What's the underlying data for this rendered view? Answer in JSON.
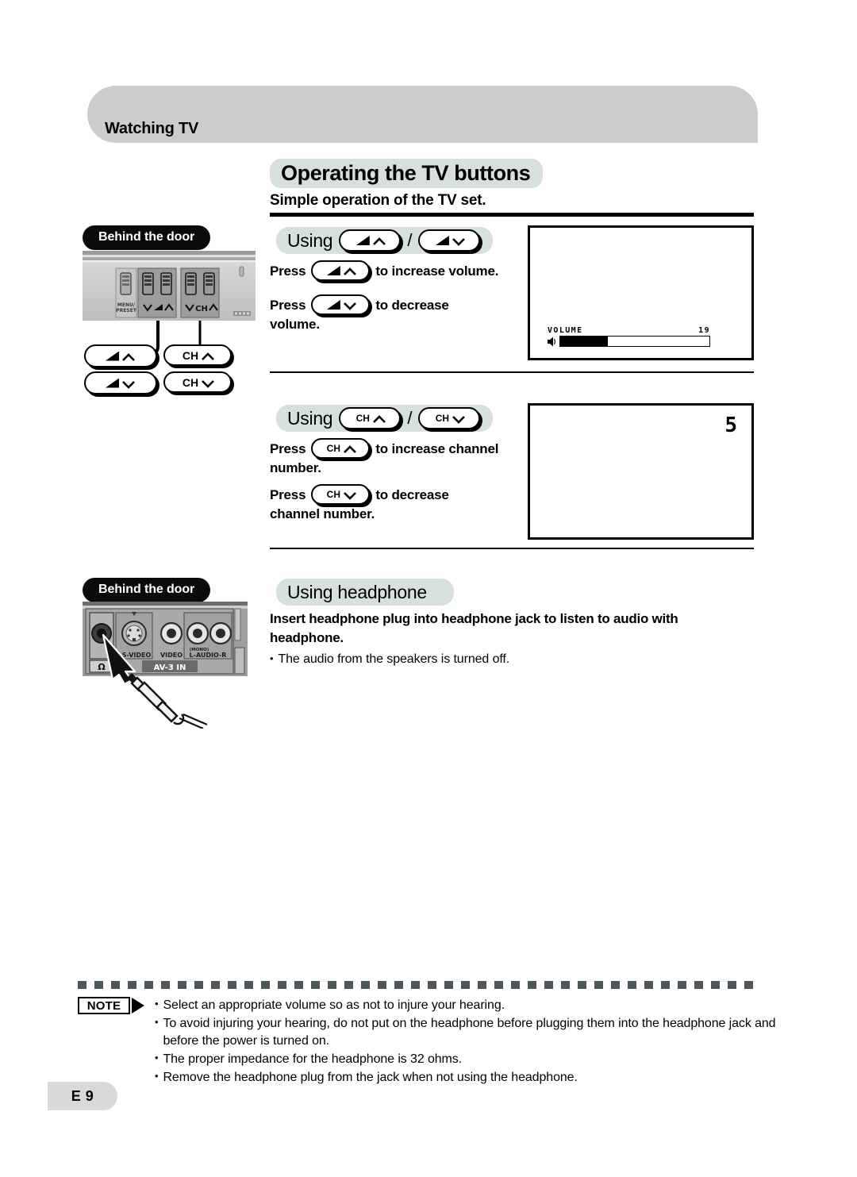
{
  "header": {
    "section_label": "Watching TV"
  },
  "title": {
    "main": "Operating the TV buttons",
    "subtitle": "Simple operation of the TV set."
  },
  "badges": {
    "behind_the_door": "Behind the door",
    "note": "NOTE"
  },
  "sections": {
    "volume": {
      "using_word": "Using",
      "slash": "/",
      "key_up_label": "",
      "key_down_label": "",
      "press_word": "Press",
      "increase_text": "to increase volume.",
      "decrease_text": "to decrease",
      "decrease_text_cont": "volume."
    },
    "channel": {
      "using_word": "Using",
      "slash": "/",
      "key_up_label": "CH",
      "key_down_label": "CH",
      "press_word": "Press",
      "increase_text": "to increase channel",
      "increase_text_cont": "number.",
      "decrease_text": "to decrease",
      "decrease_text_cont": "channel number."
    },
    "headphone": {
      "heading": "Using headphone",
      "lead": "Insert headphone plug into headphone jack to listen to audio with headphone.",
      "bullet": "The audio from the speakers is turned off.",
      "bullet_marker": "•"
    }
  },
  "osd": {
    "volume": {
      "label": "VOLUME",
      "value": "19",
      "fill_percent": 32
    },
    "channel": {
      "value": "5"
    }
  },
  "panel_illustration": {
    "menu_preset_line1": "MENU/",
    "menu_preset_line2": "PRESET",
    "volume_group_label": "CH",
    "vol_down_glyph": "∨",
    "vol_up_glyph": "∧",
    "ch_label": "CH"
  },
  "jack_illustration": {
    "headphone_symbol": "Ω",
    "svideo_label": "S-VIDEO",
    "video_label": "VIDEO",
    "audio_label": "L-AUDIO-R",
    "mono_label": "(MONO)",
    "av_in_label": "AV-3 IN"
  },
  "callout_keys": {
    "volume_up": "",
    "volume_down": "",
    "channel_up": "CH",
    "channel_down": "CH"
  },
  "notes": [
    "Select an appropriate volume so as not to injure your hearing.",
    "To avoid injuring your hearing, do not put on the headphone before plugging them into the headphone jack and before the power is turned on.",
    "The proper impedance for the headphone is 32 ohms.",
    "Remove the headphone plug from the jack when not using the headphone."
  ],
  "note_bullet_marker": "•",
  "footer": {
    "page_label": "E 9"
  },
  "colors": {
    "header_band": "#cccccc",
    "title_highlight": "#d6e0dd",
    "badge_black": "#0b0b0b",
    "dash_rule": "#4d565a",
    "page_tab": "#d9d9d9"
  }
}
